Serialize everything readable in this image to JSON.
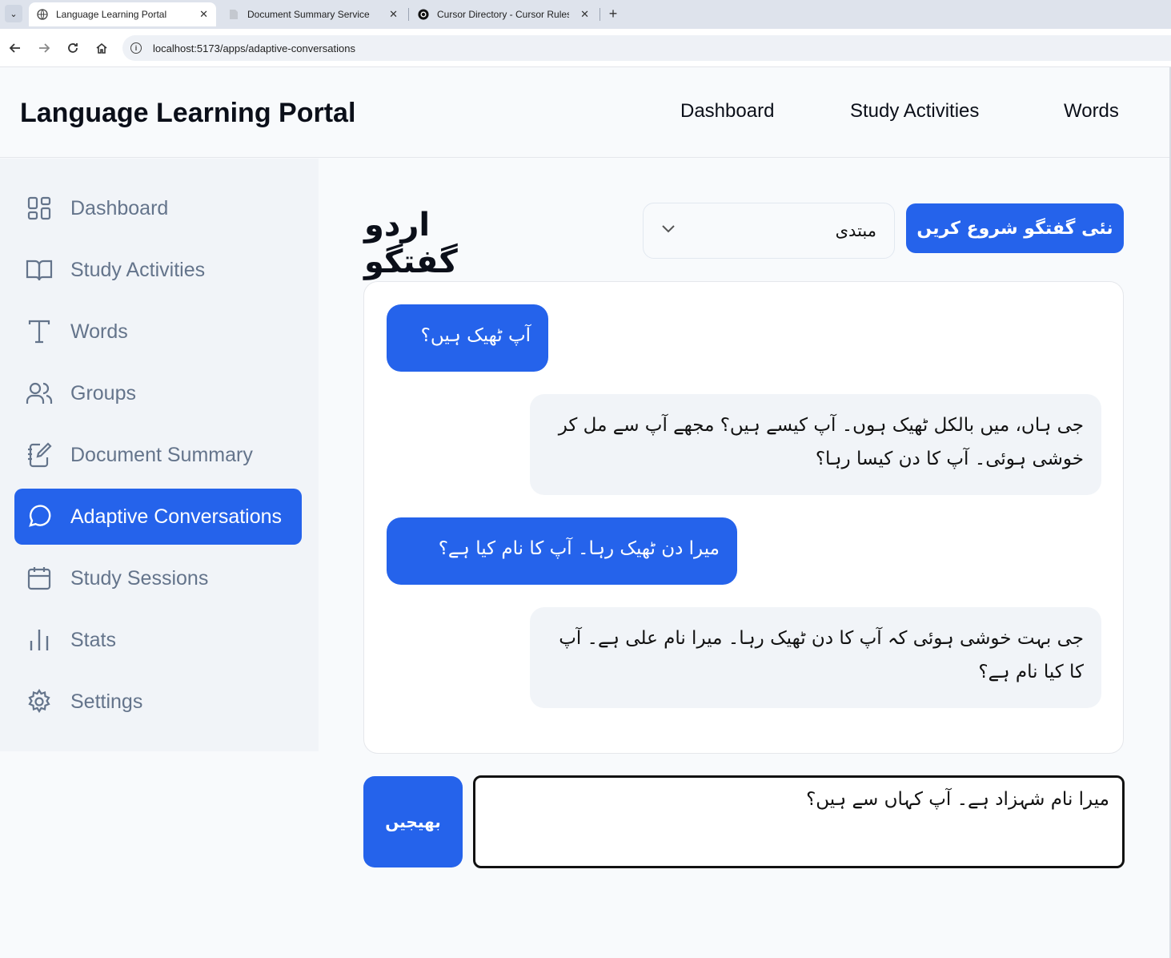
{
  "browser": {
    "tabs": [
      {
        "title": "Language Learning Portal",
        "active": true,
        "icon": "globe-icon"
      },
      {
        "title": "Document Summary Service",
        "active": false,
        "icon": "document-icon"
      },
      {
        "title": "Cursor Directory - Cursor Rules",
        "active": false,
        "icon": "cursor-icon"
      }
    ],
    "url": "localhost:5173/apps/adaptive-conversations"
  },
  "header": {
    "brand": "Language Learning Portal",
    "nav": [
      "Dashboard",
      "Study Activities",
      "Words"
    ]
  },
  "sidebar": {
    "items": [
      {
        "label": "Dashboard",
        "icon": "grid-icon",
        "active": false
      },
      {
        "label": "Study Activities",
        "icon": "book-open-icon",
        "active": false
      },
      {
        "label": "Words",
        "icon": "type-icon",
        "active": false
      },
      {
        "label": "Groups",
        "icon": "users-icon",
        "active": false
      },
      {
        "label": "Document Summary",
        "icon": "notebook-pen-icon",
        "active": false
      },
      {
        "label": "Adaptive Conversations",
        "icon": "message-circle-icon",
        "active": true
      },
      {
        "label": "Study Sessions",
        "icon": "calendar-icon",
        "active": false
      },
      {
        "label": "Stats",
        "icon": "bar-chart-icon",
        "active": false
      },
      {
        "label": "Settings",
        "icon": "gear-icon",
        "active": false
      }
    ]
  },
  "main": {
    "title": "اردو گفتگو",
    "level": {
      "selected": "مبتدی"
    },
    "new_conversation_label": "نئی گفتگو شروع کریں",
    "messages": [
      {
        "role": "user",
        "text": "آپ ٹھیک ہیں؟"
      },
      {
        "role": "bot",
        "text": "جی ہاں، میں بالکل ٹھیک ہوں۔ آپ کیسے ہیں؟ مجھے آپ سے مل کر خوشی ہوئی۔ آپ کا دن کیسا رہا؟"
      },
      {
        "role": "user",
        "text": "میرا دن ٹھیک رہا۔ آپ کا نام کیا ہے؟"
      },
      {
        "role": "bot",
        "text": "جی بہت خوشی ہوئی کہ آپ کا دن ٹھیک رہا۔ میرا نام علی ہے۔ آپ کا کیا نام ہے؟"
      }
    ],
    "send_label": "بھیجیں",
    "input_value": "میرا نام شہزاد ہے۔ آپ کہاں سے ہیں؟"
  },
  "colors": {
    "accent": "#2563eb",
    "sidebar_bg": "#f1f4f8",
    "muted_text": "#64748b"
  }
}
